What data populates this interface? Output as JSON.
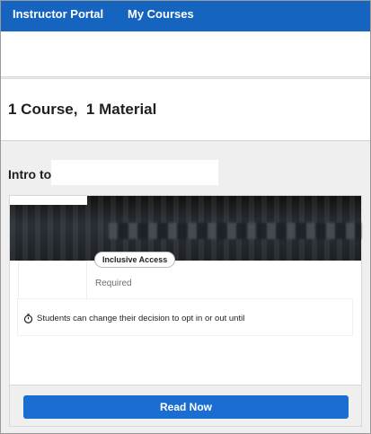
{
  "nav": {
    "portal_label": "Instructor Portal",
    "courses_label": "My Courses"
  },
  "summary": {
    "title": "1 Course,  1 Material"
  },
  "course": {
    "title": "Intro to",
    "material": {
      "badge": "Inclusive Access",
      "status": "Required",
      "notice": "Students can change their decision to opt in or out until",
      "cta_label": "Read Now"
    }
  },
  "colors": {
    "nav_bg": "#1565c0",
    "button_bg": "#1a6ed1"
  },
  "icons": {
    "notice": "timer-icon"
  }
}
